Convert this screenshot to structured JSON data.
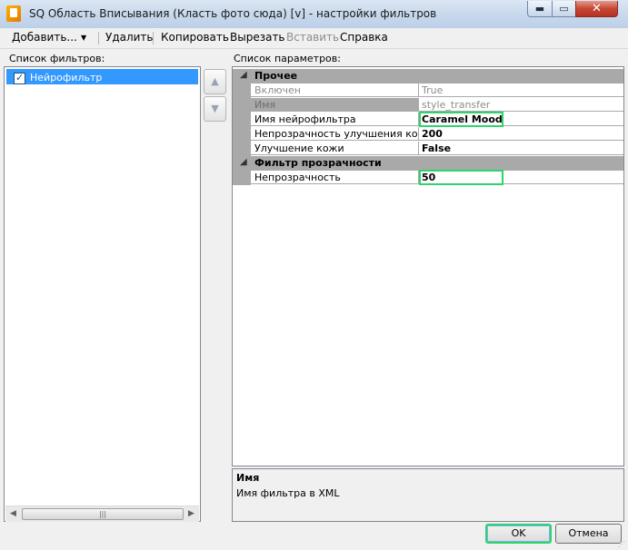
{
  "window": {
    "title": "SQ Область Вписывания (Класть фото сюда) [v] - настройки фильтров",
    "minimize_glyph": "▬",
    "maximize_glyph": "▭",
    "close_glyph": "✕"
  },
  "menu": {
    "add": "Добавить...",
    "add_arrow": "▼",
    "delete": "Удалить",
    "copy": "Копировать",
    "cut": "Вырезать",
    "paste": "Вставить",
    "help": "Справка"
  },
  "filters": {
    "label": "Список фильтров:",
    "items": [
      {
        "name": "Нейрофильтр",
        "checked": true,
        "check_glyph": "✓"
      }
    ],
    "scroll_thumb": "|||",
    "scroll_left": "◀",
    "scroll_right": "▶"
  },
  "order_buttons": {
    "up": "▲",
    "down": "▼"
  },
  "params": {
    "label": "Список параметров:",
    "collapse_glyph": "◢",
    "categories": [
      {
        "title": "Прочее",
        "rows": [
          {
            "name": "Включен",
            "value": "True"
          },
          {
            "name": "Имя",
            "value": "style_transfer"
          },
          {
            "name": "Имя нейрофильтра",
            "value": "Caramel Mood"
          },
          {
            "name": "Непрозрачность улучшения кожи",
            "value": "200"
          },
          {
            "name": "Улучшение кожи",
            "value": "False"
          }
        ]
      },
      {
        "title": "Фильтр прозрачности",
        "rows": [
          {
            "name": "Непрозрачность",
            "value": "50"
          }
        ]
      }
    ]
  },
  "description": {
    "title": "Имя",
    "text": "Имя фильтра в XML"
  },
  "buttons": {
    "ok": "OK",
    "cancel": "Отмена"
  },
  "grip_glyph": "⋰",
  "colors": {
    "selection": "#3399ff",
    "highlight_border": "#2fd36b",
    "category_bg": "#a9a9a9"
  }
}
